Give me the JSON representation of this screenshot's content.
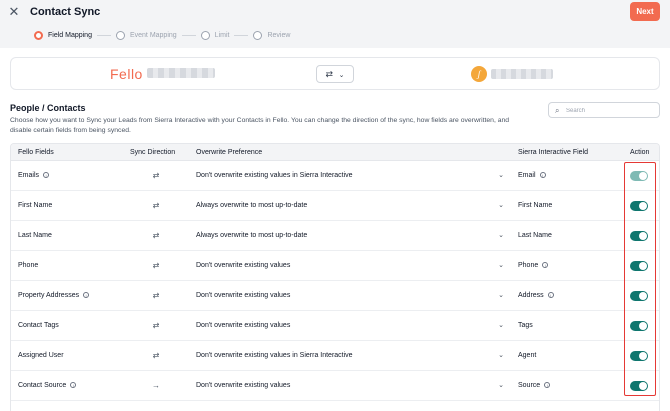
{
  "header": {
    "close_icon": "close-icon",
    "title": "Contact Sync",
    "next_label": "Next",
    "accent_color": "#f26b50"
  },
  "steps": [
    {
      "label": "Field Mapping",
      "active": true
    },
    {
      "label": "Event Mapping",
      "active": false
    },
    {
      "label": "Limit",
      "active": false
    },
    {
      "label": "Review",
      "active": false
    }
  ],
  "sync_card": {
    "left_app": "Fello",
    "swap_icon": "swap-icon",
    "right_app_initial": "ʃ"
  },
  "section": {
    "title": "People / Contacts",
    "description": "Choose how you want to Sync your Leads from Sierra Interactive with your Contacts in Fello. You can change the direction of the sync, how fields are overwritten, and disable certain fields from being synced."
  },
  "search": {
    "placeholder": "Search",
    "value": ""
  },
  "table": {
    "headers": {
      "fello_fields": "Fello Fields",
      "sync_direction": "Sync Direction",
      "overwrite": "Overwrite Preference",
      "si_field": "Sierra Interactive Field",
      "action": "Action"
    },
    "rows": [
      {
        "fello": "Emails",
        "fello_info": true,
        "direction": "⇄",
        "preference": "Don't overwrite existing values in Sierra Interactive",
        "si": "Email",
        "si_info": true,
        "enabled": true,
        "locked": true
      },
      {
        "fello": "First Name",
        "fello_info": false,
        "direction": "⇄",
        "preference": "Always overwrite to most up-to-date",
        "si": "First Name",
        "si_info": false,
        "enabled": true,
        "locked": false
      },
      {
        "fello": "Last Name",
        "fello_info": false,
        "direction": "⇄",
        "preference": "Always overwrite to most up-to-date",
        "si": "Last Name",
        "si_info": false,
        "enabled": true,
        "locked": false
      },
      {
        "fello": "Phone",
        "fello_info": false,
        "direction": "⇄",
        "preference": "Don't overwrite existing values",
        "si": "Phone",
        "si_info": true,
        "enabled": true,
        "locked": false
      },
      {
        "fello": "Property Addresses",
        "fello_info": true,
        "direction": "⇄",
        "preference": "Don't overwrite existing values",
        "si": "Address",
        "si_info": true,
        "enabled": true,
        "locked": false
      },
      {
        "fello": "Contact Tags",
        "fello_info": false,
        "direction": "⇄",
        "preference": "Don't overwrite existing values",
        "si": "Tags",
        "si_info": false,
        "enabled": true,
        "locked": false
      },
      {
        "fello": "Assigned User",
        "fello_info": false,
        "direction": "⇄",
        "preference": "Don't overwrite existing values in Sierra Interactive",
        "si": "Agent",
        "si_info": false,
        "enabled": true,
        "locked": false
      },
      {
        "fello": "Contact Source",
        "fello_info": true,
        "direction": "→",
        "preference": "Don't overwrite existing values",
        "si": "Source",
        "si_info": true,
        "enabled": true,
        "locked": false
      }
    ]
  },
  "colors": {
    "toggle_on": "#0f766e",
    "toggle_locked": "#7fbab4",
    "highlight": "#e53935"
  }
}
